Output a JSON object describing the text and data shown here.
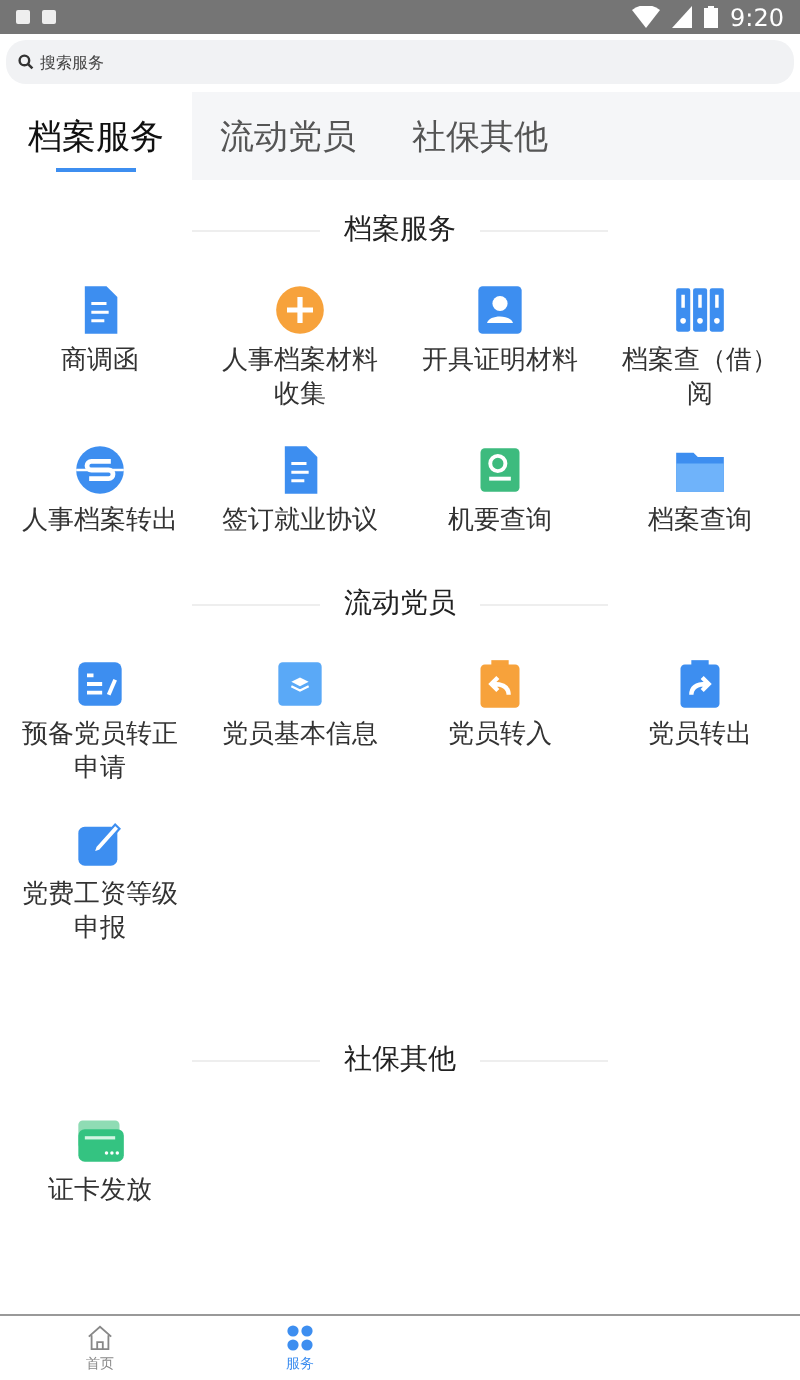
{
  "status_bar": {
    "time": "9:20"
  },
  "search": {
    "placeholder": "搜索服务"
  },
  "tabs": [
    {
      "label": "档案服务",
      "selected": true
    },
    {
      "label": "流动党员",
      "selected": false
    },
    {
      "label": "社保其他",
      "selected": false
    }
  ],
  "sections": [
    {
      "title": "档案服务",
      "items": [
        {
          "label": "商调函",
          "kind": "document"
        },
        {
          "label": "人事档案材料收集",
          "kind": "plus"
        },
        {
          "label": "开具证明材料",
          "kind": "person"
        },
        {
          "label": "档案查（借）阅",
          "kind": "binders"
        },
        {
          "label": "人事档案转出",
          "kind": "transfer"
        },
        {
          "label": "签订就业协议",
          "kind": "document"
        },
        {
          "label": "机要查询",
          "kind": "book"
        },
        {
          "label": "档案查询",
          "kind": "folder"
        }
      ]
    },
    {
      "title": "流动党员",
      "items": [
        {
          "label": "预备党员转正申请",
          "kind": "form"
        },
        {
          "label": "党员基本信息",
          "kind": "layers"
        },
        {
          "label": "党员转入",
          "kind": "inbound"
        },
        {
          "label": "党员转出",
          "kind": "outbound"
        },
        {
          "label": "党费工资等级申报",
          "kind": "edit"
        }
      ]
    },
    {
      "title": "社保其他",
      "items": [
        {
          "label": "证卡发放",
          "kind": "card"
        }
      ]
    }
  ],
  "bottom_nav": [
    {
      "label": "首页",
      "kind": "home",
      "selected": false
    },
    {
      "label": "服务",
      "kind": "grid",
      "selected": true
    }
  ]
}
